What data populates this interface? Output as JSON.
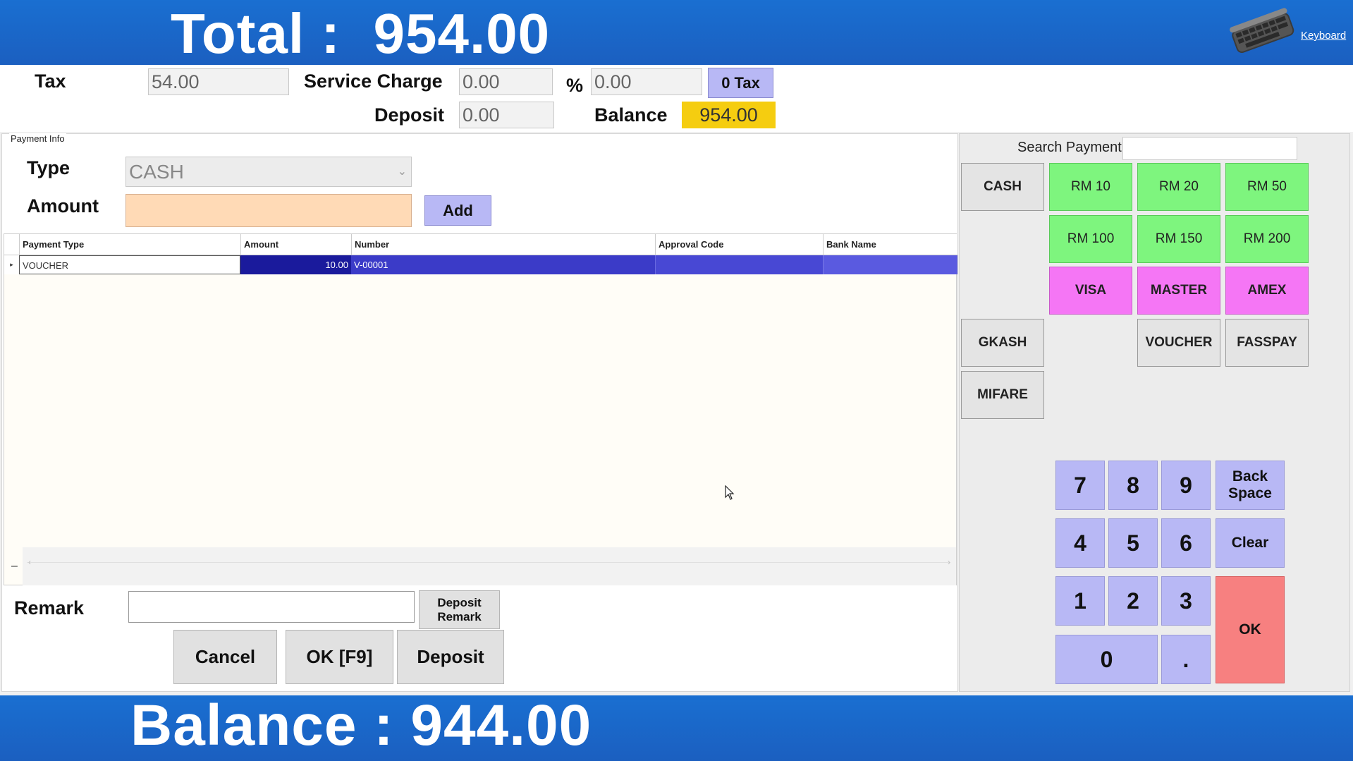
{
  "top": {
    "total_text": "Total :  954.00",
    "keyboard_label": "Keyboard"
  },
  "header": {
    "tax_label": "Tax",
    "tax_value": "54.00",
    "service_label": "Service Charge",
    "service_value": "0.00",
    "percent_label": "%",
    "percent_value": "0.00",
    "zero_tax_label": "0 Tax",
    "deposit_label": "Deposit",
    "deposit_value": "0.00",
    "balance_label": "Balance",
    "balance_value": "954.00"
  },
  "payment_info": {
    "group_title": "Payment Info",
    "type_label": "Type",
    "type_value": "CASH",
    "amount_label": "Amount",
    "amount_value": "",
    "add_label": "Add"
  },
  "grid": {
    "columns": [
      "Payment Type",
      "Amount",
      "Number",
      "Approval Code",
      "Bank Name"
    ],
    "rows": [
      {
        "indicator": "▸",
        "payment_type": "VOUCHER",
        "amount": "10.00",
        "number": "V-00001",
        "approval_code": "",
        "bank_name": ""
      }
    ],
    "minus": "–",
    "scroll_left": "‹",
    "scroll_right": "›"
  },
  "remark": {
    "label": "Remark",
    "value": "",
    "deposit_remark_label": "Deposit Remark"
  },
  "actions": {
    "cancel": "Cancel",
    "ok_f9": "OK [F9]",
    "deposit": "Deposit"
  },
  "payment_methods": {
    "search_label": "Search Payment",
    "search_value": "",
    "cash": "CASH",
    "rm10": "RM 10",
    "rm20": "RM 20",
    "rm50": "RM 50",
    "rm100": "RM 100",
    "rm150": "RM 150",
    "rm200": "RM 200",
    "visa": "VISA",
    "master": "MASTER",
    "amex": "AMEX",
    "gkash": "GKASH",
    "voucher": "VOUCHER",
    "fasspay": "FASSPAY",
    "mifare": "MIFARE"
  },
  "keypad": {
    "k7": "7",
    "k8": "8",
    "k9": "9",
    "backspace": "Back Space",
    "k4": "4",
    "k5": "5",
    "k6": "6",
    "clear": "Clear",
    "k1": "1",
    "k2": "2",
    "k3": "3",
    "ok": "OK",
    "k0": "0",
    "dot": "."
  },
  "bottom": {
    "balance_text": "Balance : 944.00"
  },
  "colors": {
    "banner": "#1b66c9",
    "balance_highlight": "#f5cd10",
    "keypad": "#b8b8f5",
    "cash_green": "#7ef57e",
    "card_pink": "#f576f5",
    "ok_red": "#f78080",
    "amount_input": "#ffdab6"
  }
}
